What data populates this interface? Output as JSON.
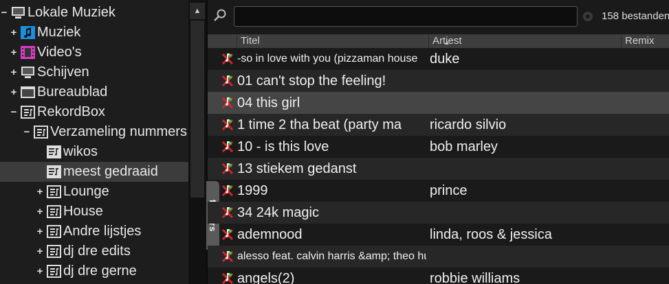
{
  "tree": {
    "items": [
      {
        "label": "Lokale Muziek",
        "expander": "−",
        "icon": "computer-icon"
      },
      {
        "label": "Muziek",
        "expander": "+",
        "icon": "music-note-icon"
      },
      {
        "label": "Video's",
        "expander": "+",
        "icon": "film-icon"
      },
      {
        "label": "Schijven",
        "expander": "+",
        "icon": "monitor-icon"
      },
      {
        "label": "Bureaublad",
        "expander": "+",
        "icon": "desktop-icon"
      },
      {
        "label": "RekordBox",
        "expander": "−",
        "icon": "playlist-folder-icon"
      },
      {
        "label": "Verzameling nummers",
        "expander": "−",
        "icon": "playlist-folder-icon"
      },
      {
        "label": "wikos",
        "expander": "",
        "icon": "playlist-icon"
      },
      {
        "label": "meest gedraaid",
        "expander": "",
        "icon": "playlist-icon"
      },
      {
        "label": "Lounge",
        "expander": "+",
        "icon": "playlist-folder-icon"
      },
      {
        "label": "House",
        "expander": "+",
        "icon": "playlist-folder-icon"
      },
      {
        "label": "Andre lijstjes",
        "expander": "+",
        "icon": "playlist-folder-icon"
      },
      {
        "label": "dj dre edits",
        "expander": "+",
        "icon": "playlist-folder-icon"
      },
      {
        "label": "dj dre gerne",
        "expander": "+",
        "icon": "playlist-folder-icon"
      }
    ]
  },
  "side_tab": {
    "label": "folders"
  },
  "search": {
    "value": "",
    "placeholder": ""
  },
  "file_count": "158 bestanden",
  "columns": {
    "title": "Titel",
    "artist": "Artiest",
    "remix": "Remix"
  },
  "tracks": [
    {
      "title": "-so in love with you (pizzaman house",
      "artist": "duke"
    },
    {
      "title": "01 can't stop the feeling!",
      "artist": ""
    },
    {
      "title": "04 this girl",
      "artist": ""
    },
    {
      "title": "1 time 2 tha beat (party ma",
      "artist": "ricardo silvio"
    },
    {
      "title": "10 - is this love",
      "artist": "bob marley"
    },
    {
      "title": "13 stiekem gedanst",
      "artist": ""
    },
    {
      "title": "1999",
      "artist": "prince"
    },
    {
      "title": "34 24k magic",
      "artist": ""
    },
    {
      "title": "ademnood",
      "artist": "linda, roos & jessica"
    },
    {
      "title": "alesso feat. calvin harris &amp; theo hu...",
      "artist": ""
    },
    {
      "title": "angels(2)",
      "artist": "robbie williams"
    }
  ],
  "colors": {
    "accent_music": "#1a8fe0",
    "accent_video": "#d93cc4",
    "track_icon_red": "#d22",
    "track_icon_green": "#3c3"
  }
}
